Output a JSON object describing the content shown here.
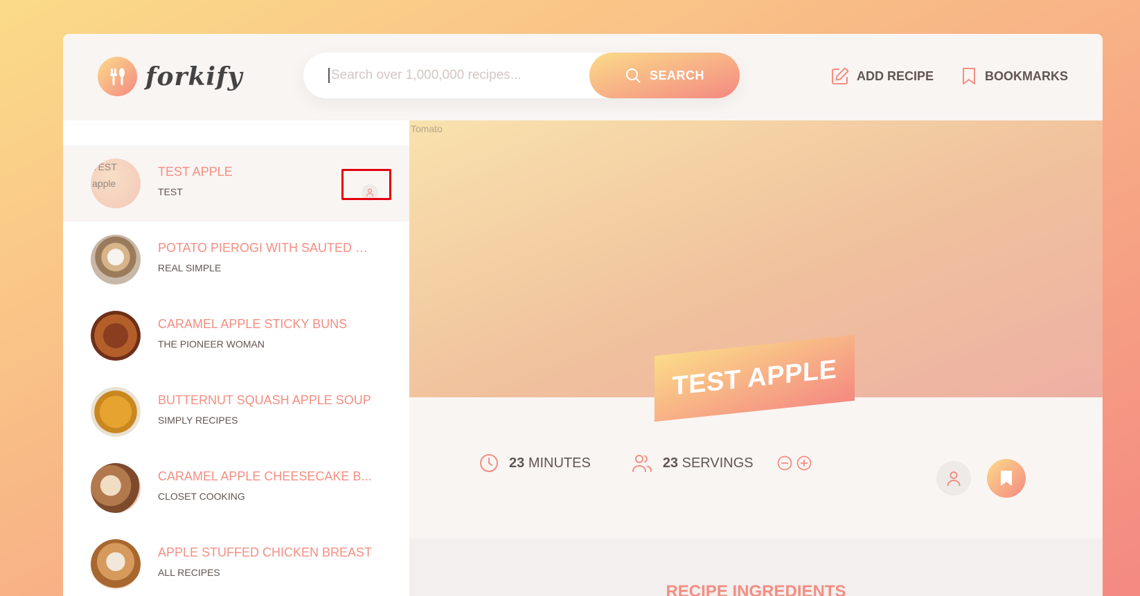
{
  "header": {
    "logo_text": "forkify",
    "search": {
      "placeholder": "Search over 1,000,000 recipes...",
      "button_label": "SEARCH"
    },
    "nav": {
      "add_recipe": "ADD RECIPE",
      "bookmarks": "BOOKMARKS"
    }
  },
  "results": [
    {
      "image_alt": "TEST apple",
      "title": "TEST APPLE",
      "publisher": "TEST",
      "user_generated": true,
      "active": true
    },
    {
      "title": "POTATO PIEROGI WITH SAUTED C...",
      "publisher": "REAL SIMPLE"
    },
    {
      "title": "CARAMEL APPLE STICKY BUNS",
      "publisher": "THE PIONEER WOMAN"
    },
    {
      "title": "BUTTERNUT SQUASH APPLE SOUP",
      "publisher": "SIMPLY RECIPES"
    },
    {
      "title": "CARAMEL APPLE CHEESECAKE B...",
      "publisher": "CLOSET COOKING"
    },
    {
      "title": "APPLE STUFFED CHICKEN BREAST",
      "publisher": "ALL RECIPES"
    }
  ],
  "recipe": {
    "image_alt": "Tomato",
    "title": "TEST APPLE",
    "minutes": "23",
    "minutes_label": "MINUTES",
    "servings": "23",
    "servings_label": "SERVINGS",
    "ingredients_heading": "RECIPE INGREDIENTS"
  },
  "colors": {
    "accent": "#f38e82",
    "gradient_start": "#fbdb89",
    "gradient_end": "#f48982",
    "highlight": "#e4000e"
  }
}
